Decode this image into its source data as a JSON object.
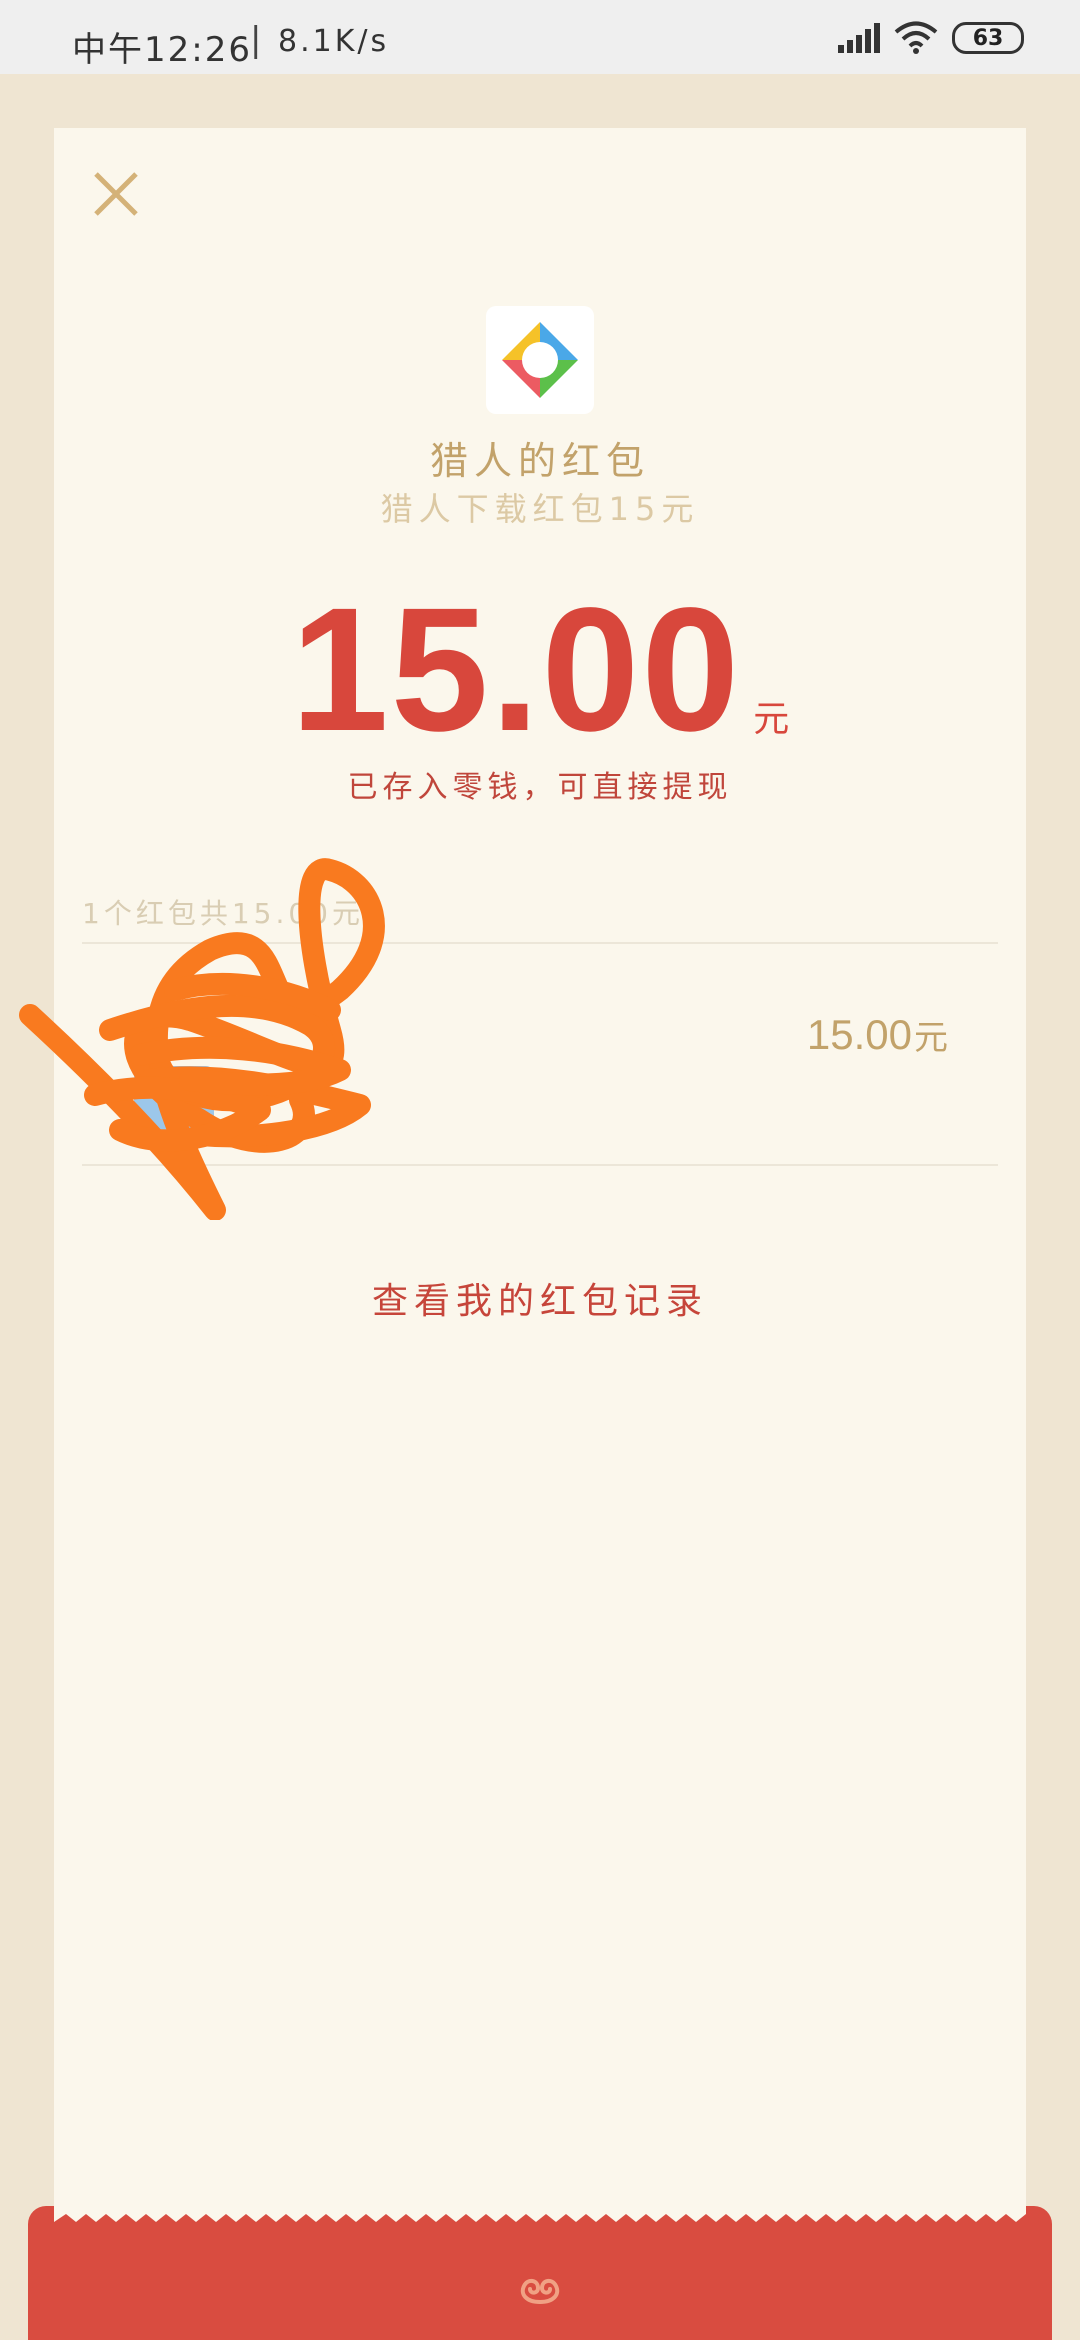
{
  "status_bar": {
    "time": "中午12:26",
    "separator": "|",
    "network_speed": "8.1K/s",
    "battery": "63",
    "icons": [
      "signal-icon",
      "wifi-icon",
      "battery-icon"
    ]
  },
  "header": {
    "close_icon": "close-icon",
    "app_logo": "hunter-logo-icon",
    "sender_title": "猎人的红包",
    "subtitle": "猎人下载红包15元"
  },
  "amount": {
    "value": "15.00",
    "unit": "元",
    "note": "已存入零钱，可直接提现"
  },
  "records": {
    "summary": "1个红包共15.00元",
    "items": [
      {
        "amount": "15.00",
        "unit": "元"
      }
    ]
  },
  "footer": {
    "history_link": "查看我的红包记录"
  },
  "colors": {
    "accent_red": "#d8473c",
    "gold": "#c2a26a",
    "card_bg": "#fbf7ec",
    "page_bg": "#efe5d2",
    "scribble": "#f97a1f"
  }
}
